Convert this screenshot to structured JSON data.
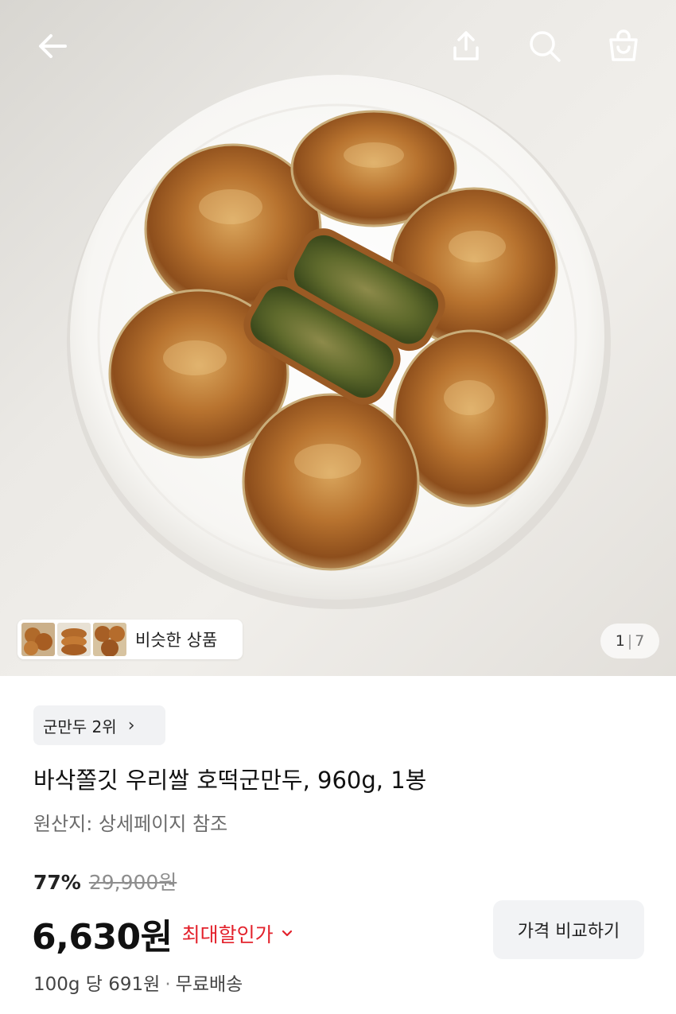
{
  "topbar": {
    "back_icon": "arrow-left-icon",
    "share_icon": "share-icon",
    "search_icon": "search-icon",
    "cart_icon": "shopping-bag-icon"
  },
  "hero": {
    "similar_label": "비슷한 상품",
    "counter_current": "1",
    "counter_total": "7"
  },
  "product": {
    "rank_badge": "군만두 2위",
    "title": "바삭쫄깃 우리쌀 호떡군만두, 960g, 1봉",
    "origin": "원산지: 상세페이지 참조",
    "discount": "77%",
    "original_price": "29,900원",
    "price": "6,630원",
    "best_price_label": "최대할인가",
    "unit_price": "100g 당 691원",
    "shipping": "무료배송",
    "compare_button": "가격 비교하기"
  },
  "colors": {
    "accent_red": "#e3222c",
    "badge_bg": "#f1f2f4",
    "button_bg": "#f2f3f5"
  }
}
